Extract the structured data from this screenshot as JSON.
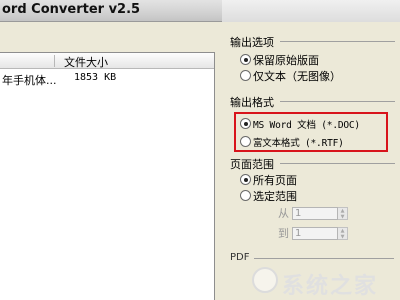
{
  "window": {
    "title": "ord Converter v2.5"
  },
  "file_list": {
    "columns": {
      "size": "文件大小"
    },
    "rows": [
      {
        "name": "年手机体...",
        "size": "1853 KB"
      }
    ]
  },
  "output_options": {
    "label": "输出选项",
    "options": [
      {
        "label": "保留原始版面",
        "checked": true
      },
      {
        "label": "仅文本（无图像）",
        "checked": false
      }
    ]
  },
  "output_format": {
    "label": "输出格式",
    "options": [
      {
        "label": "MS Word 文档 (*.DOC)",
        "checked": true
      },
      {
        "label": "富文本格式 (*.RTF)",
        "checked": false
      }
    ],
    "highlight_color": "#d8141b"
  },
  "page_range": {
    "label": "页面范围",
    "options": [
      {
        "label": "所有页面",
        "checked": true
      },
      {
        "label": "选定范围",
        "checked": false
      }
    ],
    "from": {
      "label": "从",
      "value": "1"
    },
    "to": {
      "label": "到",
      "value": "1"
    }
  },
  "pdf_section": {
    "label": "PDF"
  },
  "watermark": {
    "text": "系统之家"
  }
}
